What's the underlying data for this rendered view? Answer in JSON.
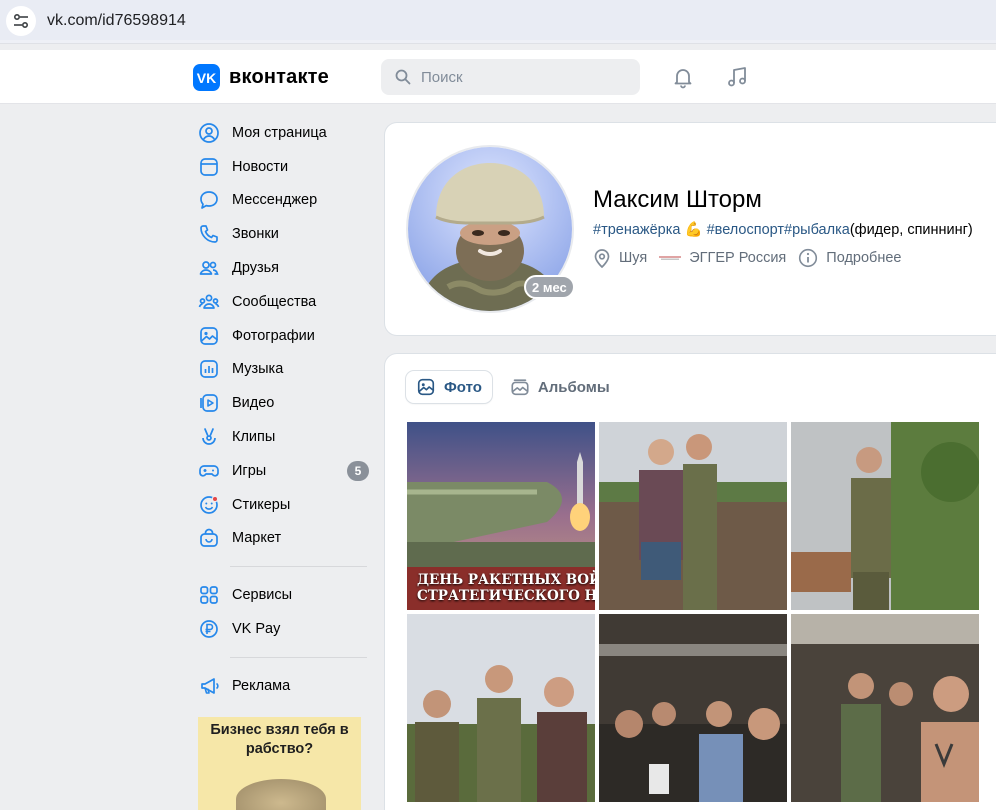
{
  "browser": {
    "url": "vk.com/id76598914"
  },
  "header": {
    "logo_text": "вконтакте",
    "logo_mark": "VK",
    "search_placeholder": "Поиск",
    "accent": "#0077ff"
  },
  "sidebar": {
    "items": [
      {
        "label": "Моя страница",
        "icon": "user-circle-icon"
      },
      {
        "label": "Новости",
        "icon": "news-icon"
      },
      {
        "label": "Мессенджер",
        "icon": "message-icon"
      },
      {
        "label": "Звонки",
        "icon": "phone-icon"
      },
      {
        "label": "Друзья",
        "icon": "friends-icon"
      },
      {
        "label": "Сообщества",
        "icon": "communities-icon"
      },
      {
        "label": "Фотографии",
        "icon": "photo-icon"
      },
      {
        "label": "Музыка",
        "icon": "music-icon"
      },
      {
        "label": "Видео",
        "icon": "video-icon"
      },
      {
        "label": "Клипы",
        "icon": "clips-icon"
      },
      {
        "label": "Игры",
        "icon": "games-icon",
        "badge": "5"
      },
      {
        "label": "Стикеры",
        "icon": "stickers-icon"
      },
      {
        "label": "Маркет",
        "icon": "market-icon"
      }
    ],
    "items2": [
      {
        "label": "Сервисы",
        "icon": "services-icon"
      },
      {
        "label": "VK Pay",
        "icon": "vkpay-icon"
      }
    ],
    "items3": [
      {
        "label": "Реклама",
        "icon": "megaphone-icon"
      }
    ],
    "ad": {
      "text": "Бизнес взял тебя в рабство?"
    }
  },
  "profile": {
    "name": "Максим Шторм",
    "status_tag1": "#тренажёрка",
    "status_emoji": "💪",
    "status_tag2": "#велоспорт",
    "status_tag3": "#рыбалка",
    "status_rest": "(фидер, спиннинг)",
    "city": "Шуя",
    "work": "ЭГГЕР Россия",
    "more": "Подробнее",
    "online_badge": "2 мес"
  },
  "photos": {
    "tab_active": "Фото",
    "tab_albums": "Альбомы",
    "items": [
      {
        "caption1": "ДЕНЬ РАКЕТНЫХ ВОЙСК",
        "caption2": "СТРАТЕГИЧЕСКОГО НАЗНА"
      },
      {},
      {},
      {},
      {},
      {}
    ]
  }
}
